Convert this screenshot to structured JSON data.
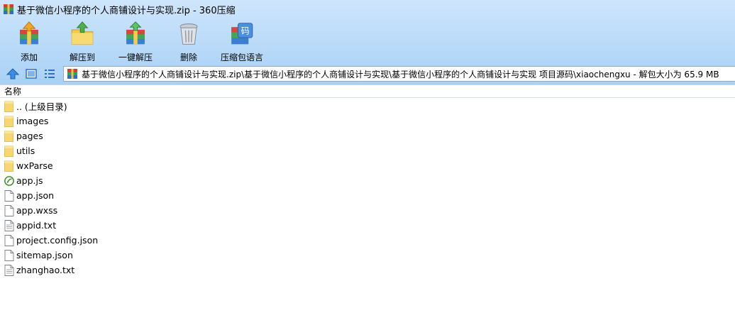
{
  "window": {
    "title": "基于微信小程序的个人商铺设计与实现.zip - 360压缩"
  },
  "toolbar": {
    "items": [
      {
        "label": "添加",
        "icon": "add-archive-icon"
      },
      {
        "label": "解压到",
        "icon": "extract-to-icon"
      },
      {
        "label": "一键解压",
        "icon": "one-click-extract-icon"
      },
      {
        "label": "删除",
        "icon": "delete-trash-icon"
      },
      {
        "label": "压缩包语言",
        "icon": "archive-language-icon"
      }
    ]
  },
  "address": {
    "path": "基于微信小程序的个人商铺设计与实现.zip\\基于微信小程序的个人商铺设计与实现\\基于微信小程序的个人商铺设计与实现 项目源码\\xiaochengxu - 解包大小为 65.9 MB"
  },
  "list": {
    "column_name": "名称",
    "items": [
      {
        "name": ".. (上级目录)",
        "type": "folder"
      },
      {
        "name": "images",
        "type": "folder"
      },
      {
        "name": "pages",
        "type": "folder"
      },
      {
        "name": "utils",
        "type": "folder"
      },
      {
        "name": "wxParse",
        "type": "folder"
      },
      {
        "name": "app.js",
        "type": "js"
      },
      {
        "name": "app.json",
        "type": "file"
      },
      {
        "name": "app.wxss",
        "type": "file"
      },
      {
        "name": "appid.txt",
        "type": "text"
      },
      {
        "name": "project.config.json",
        "type": "file"
      },
      {
        "name": "sitemap.json",
        "type": "file"
      },
      {
        "name": "zhanghao.txt",
        "type": "text"
      }
    ]
  },
  "colors": {
    "header_top": "#cfe6fb",
    "header_bottom": "#a9d1f5",
    "folder": "#f7d774"
  }
}
